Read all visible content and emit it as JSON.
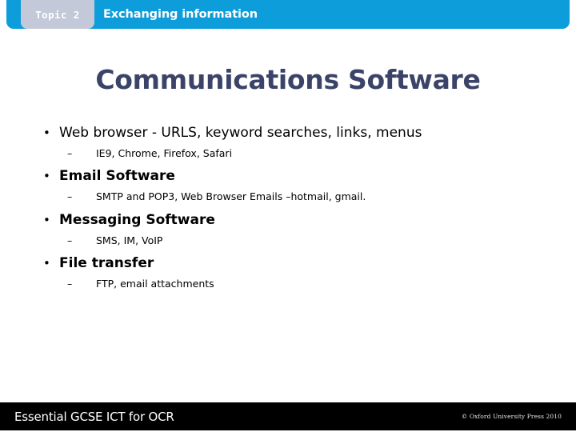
{
  "header": {
    "topic_label": "Topic 2",
    "title": "Exchanging information",
    "bar_color": "#0d9ddb",
    "chip_color": "#c3c9d8"
  },
  "slide": {
    "title": "Communications Software",
    "title_color": "#3b4468",
    "bullets": [
      {
        "level1": "Web browser - URLS, keyword searches, links, menus",
        "bold": false,
        "marker": "•",
        "sub_marker": "–",
        "level2": "IE9, Chrome, Firefox, Safari"
      },
      {
        "level1": "Email Software",
        "bold": true,
        "marker": "•",
        "sub_marker": "–",
        "level2": "SMTP and POP3, Web Browser Emails –hotmail, gmail."
      },
      {
        "level1": "Messaging Software",
        "bold": true,
        "marker": "•",
        "sub_marker": "–",
        "level2": "SMS, IM, VoIP"
      },
      {
        "level1": "File transfer",
        "bold": true,
        "marker": "•",
        "sub_marker": "–",
        "level2": "FTP, email attachments"
      }
    ]
  },
  "footer": {
    "brand": "Essential GCSE ICT for OCR",
    "copyright": "© Oxford University Press 2010",
    "bar_color": "#000000"
  }
}
